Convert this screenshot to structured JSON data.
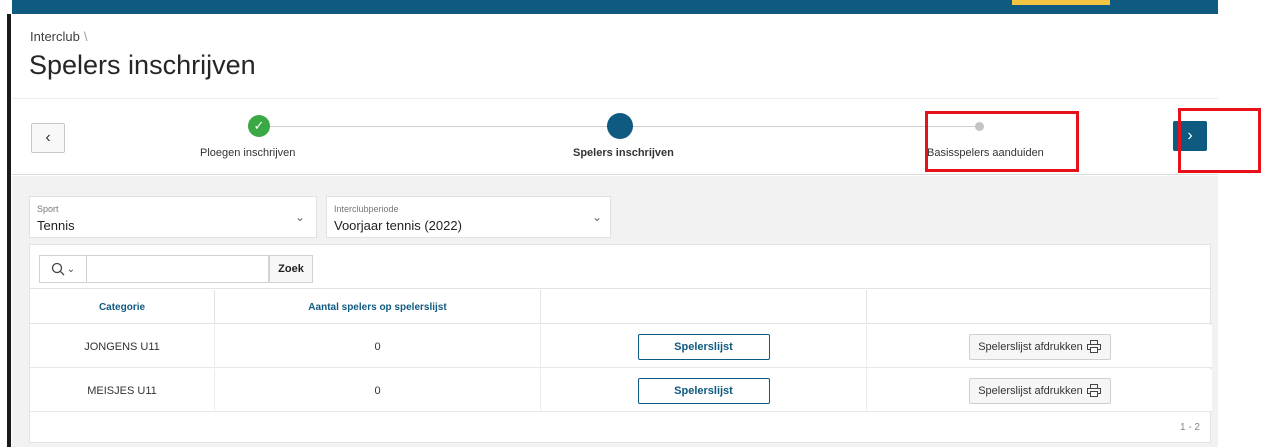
{
  "breadcrumb": {
    "item": "Interclub",
    "separator": "\\"
  },
  "page": {
    "title": "Spelers inschrijven"
  },
  "wizard": {
    "prev_icon": "chevron-left-icon",
    "next_icon": "chevron-right-icon",
    "prev_glyph": "‹",
    "next_glyph": "›",
    "check_glyph": "✓",
    "steps": [
      {
        "label": "Ploegen inschrijven",
        "state": "complete"
      },
      {
        "label": "Spelers inschrijven",
        "state": "current"
      },
      {
        "label": "Basisspelers aanduiden",
        "state": "upcoming"
      }
    ]
  },
  "filters": {
    "sport": {
      "label": "Sport",
      "value": "Tennis"
    },
    "period": {
      "label": "Interclubperiode",
      "value": "Voorjaar tennis (2022)"
    },
    "chevron_glyph": "⌄"
  },
  "search": {
    "value": "",
    "button_label": "Zoek",
    "icon": "search-icon",
    "menu_glyph": "⌄"
  },
  "table": {
    "columns": [
      "Categorie",
      "Aantal spelers op spelerslijst",
      "",
      ""
    ],
    "rows": [
      {
        "categorie": "JONGENS U11",
        "aantal": "0",
        "list_button": "Spelerslijst",
        "print_button": "Spelerslijst afdrukken"
      },
      {
        "categorie": "MEISJES U11",
        "aantal": "0",
        "list_button": "Spelerslijst",
        "print_button": "Spelerslijst afdrukken"
      }
    ],
    "pagination": "1 - 2"
  },
  "colors": {
    "brand": "#0f5a80",
    "success": "#3aa845",
    "highlight": "#e8101a"
  }
}
